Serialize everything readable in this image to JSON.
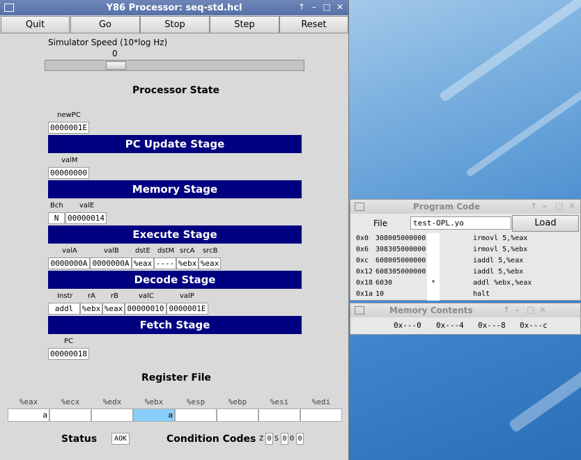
{
  "main_window": {
    "title": "Y86 Processor: seq-std.hcl",
    "buttons": [
      "Quit",
      "Go",
      "Stop",
      "Step",
      "Reset"
    ],
    "speed_label": "Simulator Speed (10*log Hz)",
    "speed_value": "0",
    "processor_state_heading": "Processor State",
    "newpc": {
      "label": "newPC",
      "value": "0000001E"
    },
    "pc_update_stage": "PC Update Stage",
    "valm": {
      "label": "valM",
      "value": "00000000"
    },
    "memory_stage": "Memory Stage",
    "bch": {
      "label": "Bch",
      "value": "N"
    },
    "vale": {
      "label": "valE",
      "value": "00000014"
    },
    "execute_stage": "Execute Stage",
    "decode_fields": [
      {
        "label": "valA",
        "value": "0000000A"
      },
      {
        "label": "valB",
        "value": "0000000A"
      },
      {
        "label": "dstE",
        "value": "%eax"
      },
      {
        "label": "dstM",
        "value": "----"
      },
      {
        "label": "srcA",
        "value": "%ebx"
      },
      {
        "label": "srcB",
        "value": "%eax"
      }
    ],
    "decode_stage": "Decode Stage",
    "fetch_fields": [
      {
        "label": "Instr",
        "value": "addl"
      },
      {
        "label": "rA",
        "value": "%ebx"
      },
      {
        "label": "rB",
        "value": "%eax"
      },
      {
        "label": "valC",
        "value": "00000010"
      },
      {
        "label": "valP",
        "value": "0000001E"
      }
    ],
    "fetch_stage": "Fetch Stage",
    "pc": {
      "label": "PC",
      "value": "00000018"
    },
    "register_file_heading": "Register File",
    "registers": [
      {
        "name": "%eax",
        "value": "a"
      },
      {
        "name": "%ecx",
        "value": ""
      },
      {
        "name": "%edx",
        "value": ""
      },
      {
        "name": "%ebx",
        "value": "a"
      },
      {
        "name": "%esp",
        "value": ""
      },
      {
        "name": "%ebp",
        "value": ""
      },
      {
        "name": "%esi",
        "value": ""
      },
      {
        "name": "%edi",
        "value": ""
      }
    ],
    "highlight_register": "%ebx",
    "highlight_color": "#87cefa",
    "status_label": "Status",
    "status_value": "AOK",
    "cc_label": "Condition Codes",
    "cc": [
      {
        "flag": "Z",
        "value": "0"
      },
      {
        "flag": "S",
        "value": "0"
      },
      {
        "flag": "O",
        "value": "0"
      }
    ]
  },
  "program_window": {
    "title": "Program Code",
    "file_label": "File",
    "file_value": "test-OPL.yo",
    "load_label": "Load",
    "rows": [
      {
        "addr": "0x0",
        "bytes": "308005000000",
        "mark": "",
        "asm": "irmovl 5,%eax"
      },
      {
        "addr": "0x6",
        "bytes": "308305000000",
        "mark": "",
        "asm": "irmovl 5,%ebx"
      },
      {
        "addr": "0xc",
        "bytes": "608005000000",
        "mark": "",
        "asm": "iaddl 5,%eax"
      },
      {
        "addr": "0x12",
        "bytes": "608305000000",
        "mark": "",
        "asm": "iaddl 5,%ebx"
      },
      {
        "addr": "0x18",
        "bytes": "6030",
        "mark": "*",
        "asm": "addl %ebx,%eax"
      },
      {
        "addr": "0x1a",
        "bytes": "10",
        "mark": "",
        "asm": "halt"
      }
    ]
  },
  "memory_window": {
    "title": "Memory Contents",
    "columns": [
      "0x---0",
      "0x---4",
      "0x---8",
      "0x---c"
    ]
  },
  "colors": {
    "stage_bg": "#000080",
    "window_bg": "#d9d9d9",
    "titlebar": "#5b77ae"
  }
}
